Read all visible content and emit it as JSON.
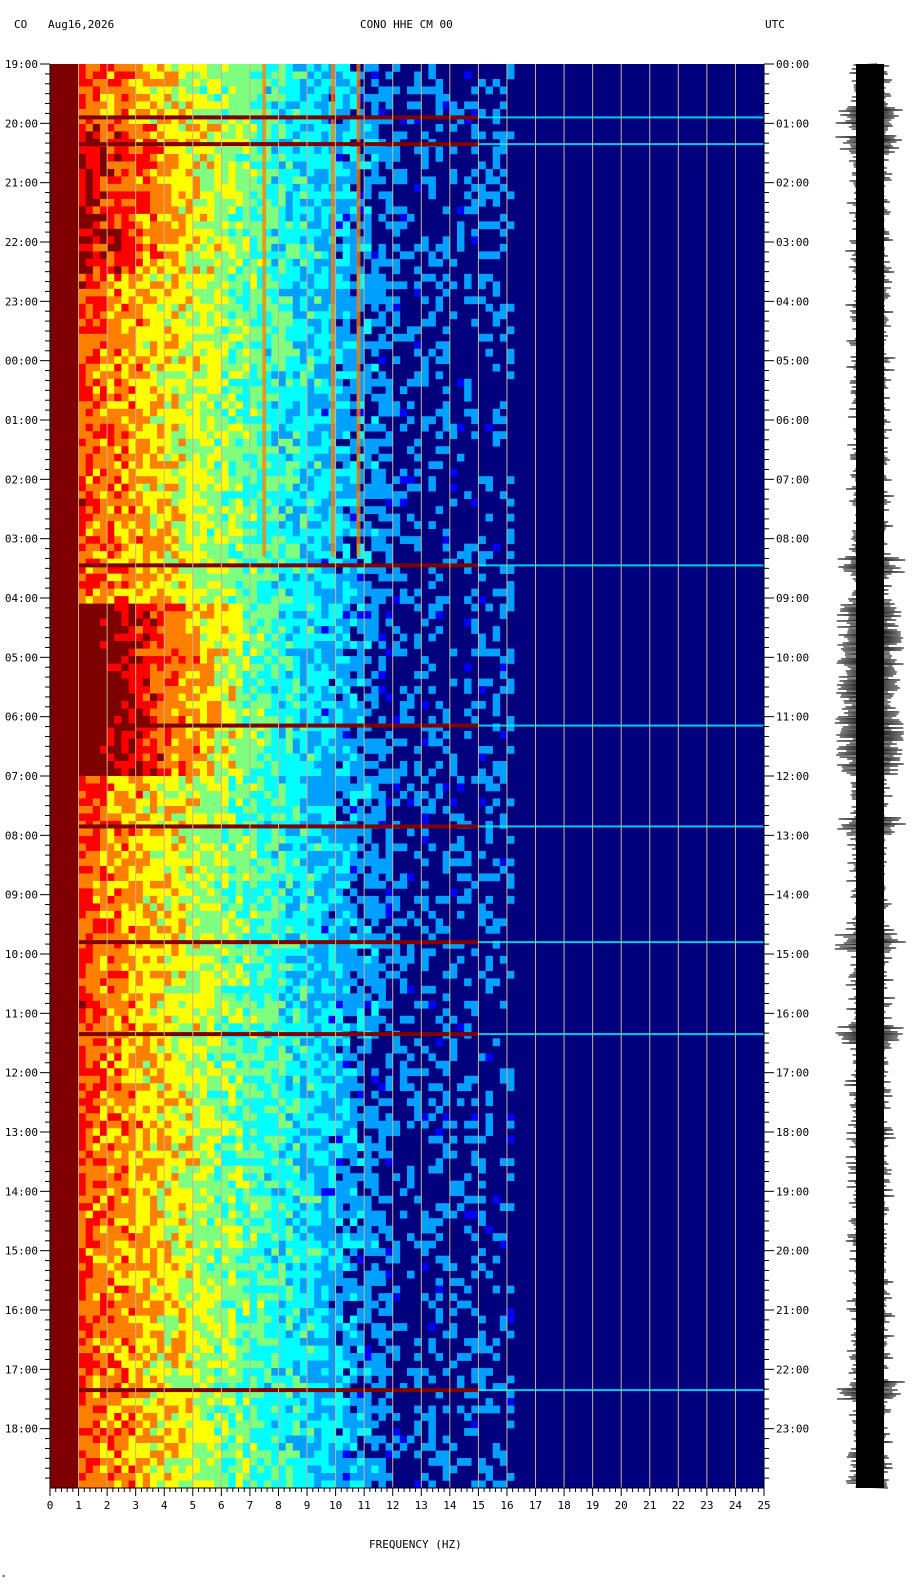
{
  "header": {
    "network": "CO",
    "date": "Aug16,2026",
    "station": "CONO HHE CM 00",
    "utc": "UTC"
  },
  "chart_data": {
    "type": "heatmap",
    "title": "CONO HHE CM 00",
    "xlabel": "FREQUENCY (HZ)",
    "xlim": [
      0,
      25
    ],
    "x_ticks": [
      "0",
      "1",
      "2",
      "3",
      "4",
      "5",
      "6",
      "7",
      "8",
      "9",
      "10",
      "11",
      "12",
      "13",
      "14",
      "15",
      "16",
      "17",
      "18",
      "19",
      "20",
      "21",
      "22",
      "23",
      "24",
      "25"
    ],
    "left_time_labels": [
      "19:00",
      "20:00",
      "21:00",
      "22:00",
      "23:00",
      "00:00",
      "01:00",
      "02:00",
      "03:00",
      "04:00",
      "05:00",
      "06:00",
      "07:00",
      "08:00",
      "09:00",
      "10:00",
      "11:00",
      "12:00",
      "13:00",
      "14:00",
      "15:00",
      "16:00",
      "17:00",
      "18:00"
    ],
    "right_time_labels": [
      "00:00",
      "01:00",
      "02:00",
      "03:00",
      "04:00",
      "05:00",
      "06:00",
      "07:00",
      "08:00",
      "09:00",
      "10:00",
      "11:00",
      "12:00",
      "13:00",
      "14:00",
      "15:00",
      "16:00",
      "17:00",
      "18:00",
      "19:00",
      "20:00",
      "21:00",
      "22:00",
      "23:00"
    ],
    "colormap": [
      "#00007f",
      "#0000ff",
      "#00a0ff",
      "#00ffff",
      "#7fff7f",
      "#ffff00",
      "#ff7f00",
      "#ff0000",
      "#7f0000"
    ],
    "strong_events_hours": [
      0.9,
      1.35,
      8.45,
      11.15,
      12.85,
      14.8,
      16.35,
      22.35
    ],
    "spectral_lines_hz": [
      10.8,
      9.9,
      7.5
    ]
  },
  "footer": {
    "mark": "*"
  }
}
